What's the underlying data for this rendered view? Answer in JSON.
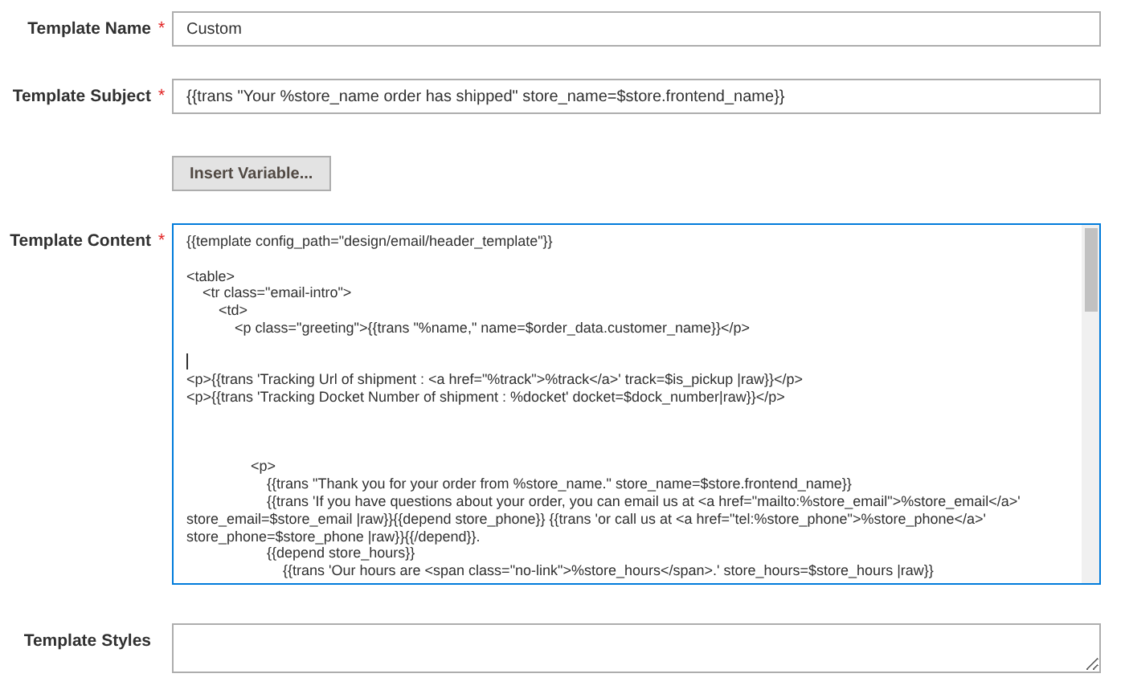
{
  "required_mark": "*",
  "fields": [
    {
      "kind": "input",
      "label": "Template Name",
      "required": true,
      "value": "Custom"
    },
    {
      "kind": "input",
      "label": "Template Subject",
      "required": true,
      "value": "{{trans \"Your %store_name order has shipped\" store_name=$store.frontend_name}}"
    },
    {
      "kind": "button",
      "label": "Insert Variable..."
    },
    {
      "kind": "code",
      "label": "Template Content",
      "required": true,
      "focused": true,
      "blocks": [
        {
          "kind": "short_gap",
          "lines": [
            "{{template config_path=\"design/email/header_template\"}}"
          ]
        },
        {
          "kind": "cursor_gap",
          "lines": [
            "<table>",
            "    <tr class=\"email-intro\">",
            "        <td>",
            "            <p class=\"greeting\">{{trans \"%name,\" name=$order_data.customer_name}}</p>"
          ]
        },
        {
          "kind": "wide_gap",
          "lines": [
            "<p>{{trans 'Tracking Url of shipment : <a href=\"%track\">%track</a>' track=$is_pickup |raw}}</p>",
            "<p>{{trans 'Tracking Docket Number of shipment : %docket' docket=$dock_number|raw}}</p>"
          ]
        },
        {
          "kind": "no_gap",
          "lines": [
            "                <p>",
            "                    {{trans \"Thank you for your order from %store_name.\" store_name=$store.frontend_name}}",
            "                    {{trans 'If you have questions about your order, you can email us at <a href=\"mailto:%store_email\">%store_email</a>' store_email=$store_email |raw}}{{depend store_phone}} {{trans 'or call us at <a href=\"tel:%store_phone\">%store_phone</a>' store_phone=$store_phone |raw}}{{/depend}}.",
            "                    {{depend store_hours}}",
            "                        {{trans 'Our hours are <span class=\"no-link\">%store_hours</span>.' store_hours=$store_hours |raw}}"
          ]
        }
      ]
    },
    {
      "kind": "plain",
      "label": "Template Styles",
      "required": false,
      "focused": false
    }
  ]
}
